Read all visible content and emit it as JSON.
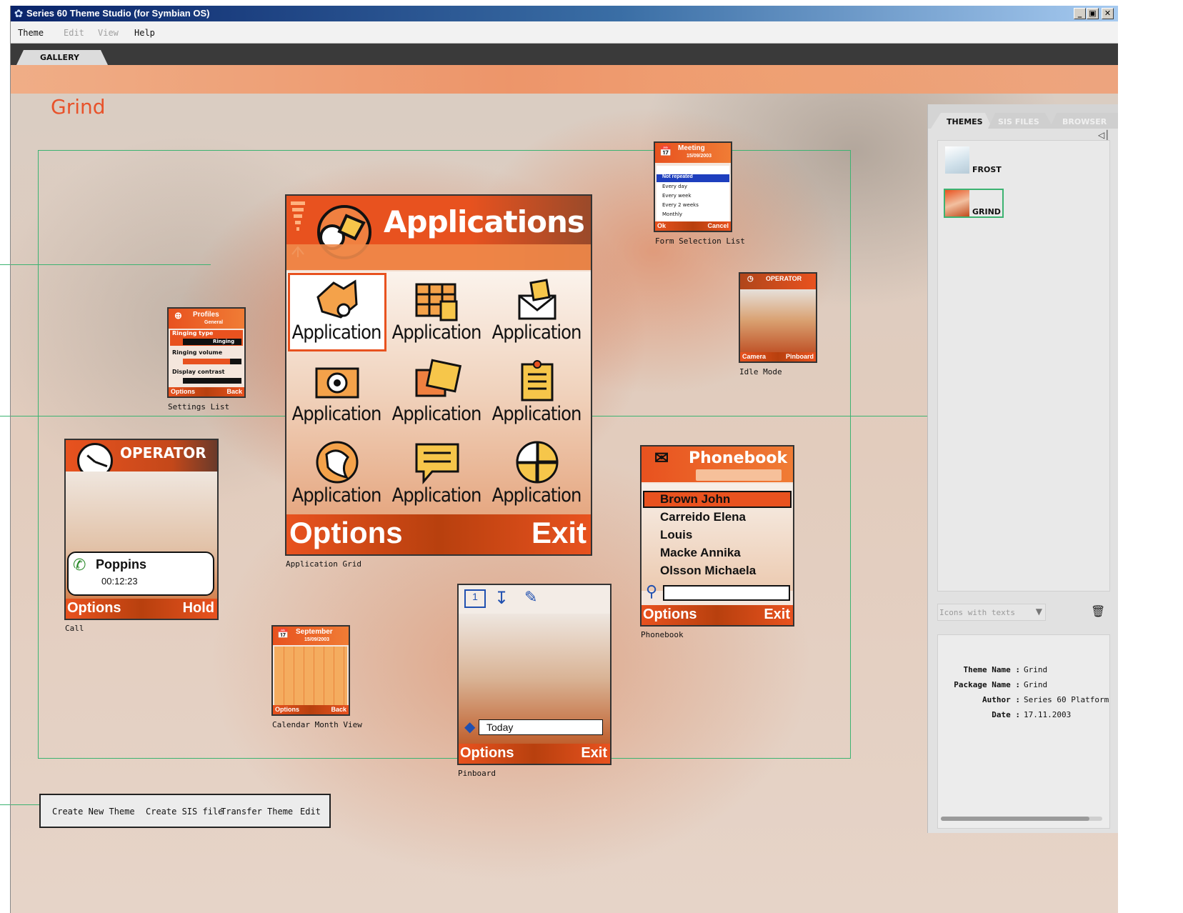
{
  "window": {
    "title": "Series 60 Theme Studio (for Symbian OS)",
    "controls": {
      "minimize": "_",
      "restore": "▣",
      "close": "✕"
    }
  },
  "menu": {
    "theme": "Theme",
    "edit": "Edit",
    "view": "View",
    "help": "Help"
  },
  "tabs": {
    "gallery": "GALLERY"
  },
  "theme_title": "Grind",
  "previews": {
    "form_selection": {
      "caption": "Form Selection List",
      "header": "Meeting",
      "subheader": "15/09/2003",
      "items": [
        "Not repeated",
        "Every day",
        "Every week",
        "Every 2 weeks",
        "Monthly"
      ],
      "left_soft": "Ok",
      "right_soft": "Cancel"
    },
    "settings_list": {
      "caption": "Settings List",
      "header": "Profiles",
      "subheader": "General",
      "rows": [
        "Ringing type",
        "Ringing",
        "Ringing volume",
        "Display contrast"
      ],
      "left_soft": "Options",
      "right_soft": "Back"
    },
    "app_grid": {
      "caption": "Application Grid",
      "header": "Applications",
      "apps": [
        "Application",
        "Application",
        "Application",
        "Application",
        "Application",
        "Application",
        "Application",
        "Application",
        "Application"
      ],
      "left_soft": "Options",
      "right_soft": "Exit"
    },
    "idle_mode": {
      "caption": "Idle Mode",
      "header": "OPERATOR",
      "left_soft": "Camera",
      "right_soft": "Pinboard"
    },
    "call": {
      "caption": "Call",
      "header": "OPERATOR",
      "caller": "Poppins",
      "duration": "00:12:23",
      "left_soft": "Options",
      "right_soft": "Hold"
    },
    "phonebook": {
      "caption": "Phonebook",
      "header": "Phonebook",
      "entries": [
        "Brown John",
        "Carreido Elena",
        "Louis",
        "Macke Annika",
        "Olsson Michaela"
      ],
      "left_soft": "Options",
      "right_soft": "Exit"
    },
    "calendar": {
      "caption": "Calendar Month View",
      "header": "September",
      "subheader": "15/09/2003",
      "left_soft": "Options",
      "right_soft": "Back"
    },
    "pinboard": {
      "caption": "Pinboard",
      "today": "Today",
      "left_soft": "Options",
      "right_soft": "Exit"
    }
  },
  "right_panel": {
    "tabs": [
      "THEMES",
      "SIS FILES",
      "BROWSER"
    ],
    "themes": [
      {
        "name": "FROST",
        "selected": false
      },
      {
        "name": "GRIND",
        "selected": true
      }
    ],
    "view_select": "Icons with texts",
    "info": [
      {
        "key": "Theme Name :",
        "value": "Grind"
      },
      {
        "key": "Package Name :",
        "value": "Grind"
      },
      {
        "key": "Author :",
        "value": "Series 60 Platform"
      },
      {
        "key": "Date :",
        "value": "17.11.2003"
      }
    ]
  },
  "actions": {
    "create_new_theme": "Create New Theme",
    "create_sis": "Create SIS file",
    "transfer": "Transfer Theme",
    "edit": "Edit"
  },
  "colors": {
    "accent": "#e8522a",
    "guide": "#3cb371",
    "title_bar": "#0a246a"
  }
}
